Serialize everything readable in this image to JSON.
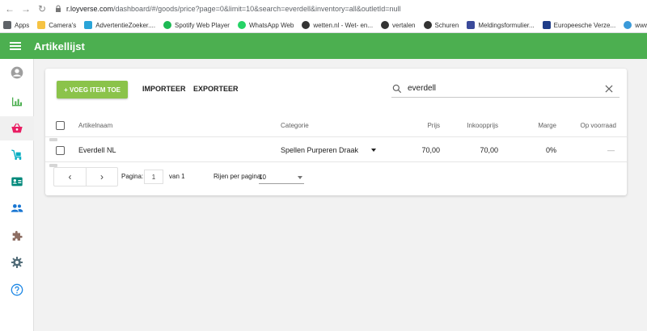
{
  "browser": {
    "url_host": "r.loyverse.com",
    "url_path": "/dashboard/#/goods/price?page=0&limit=10&search=everdell&inventory=all&outletId=null",
    "bookmarks": [
      {
        "label": "Apps",
        "icon": "apps-grid-icon",
        "color": "#5f6368"
      },
      {
        "label": "Camera's",
        "icon": "folder-icon",
        "color": "#f6c343"
      },
      {
        "label": "AdvertentieZoeker....",
        "icon": "y-icon",
        "color": "#2aa4d8"
      },
      {
        "label": "Spotify Web Player",
        "icon": "spotify-icon",
        "color": "#1db954"
      },
      {
        "label": "WhatsApp Web",
        "icon": "whatsapp-icon",
        "color": "#25d366"
      },
      {
        "label": "wetten.nl - Wet- en...",
        "icon": "globe-icon",
        "color": "#333333"
      },
      {
        "label": "vertalen",
        "icon": "globe-icon",
        "color": "#333333"
      },
      {
        "label": "Schuren",
        "icon": "globe-icon",
        "color": "#333333"
      },
      {
        "label": "Meldingsformulier...",
        "icon": "doc-icon",
        "color": "#3a4a9a"
      },
      {
        "label": "Europeesche Verze...",
        "icon": "shield-icon",
        "color": "#1f3c88"
      },
      {
        "label": "www.stichtingimn.n...",
        "icon": "wave-icon",
        "color": "#3a9ad9"
      }
    ]
  },
  "appbar": {
    "title": "Artikellijst",
    "color": "#4caf50"
  },
  "sidebar": {
    "items": [
      {
        "name": "account-icon",
        "active": false
      },
      {
        "name": "reports-icon",
        "active": false
      },
      {
        "name": "items-basket-icon",
        "active": true
      },
      {
        "name": "inventory-cart-icon",
        "active": false
      },
      {
        "name": "employees-card-icon",
        "active": false
      },
      {
        "name": "customers-icon",
        "active": false
      },
      {
        "name": "integrations-puzzle-icon",
        "active": false
      },
      {
        "name": "settings-gear-icon",
        "active": false
      },
      {
        "name": "help-icon",
        "active": false
      }
    ]
  },
  "toolbar": {
    "add_label": "+ VOEG ITEM TOE",
    "import_label": "IMPORTEER",
    "export_label": "EXPORTEER",
    "search_value": "everdell",
    "accent": "#8bc34a"
  },
  "table": {
    "headers": {
      "name": "Artikelnaam",
      "category": "Categorie",
      "price": "Prijs",
      "cost": "Inkoopprijs",
      "margin": "Marge",
      "stock": "Op voorraad"
    },
    "rows": [
      {
        "name": "Everdell NL",
        "category": "Spellen Purperen Draak",
        "price": "70,00",
        "cost": "70,00",
        "margin": "0%",
        "stock": "—"
      }
    ]
  },
  "pagination": {
    "page_label": "Pagina:",
    "page_value": "1",
    "of_label": "van 1",
    "rows_label": "Rijen per pagina:",
    "rows_value": "10"
  }
}
